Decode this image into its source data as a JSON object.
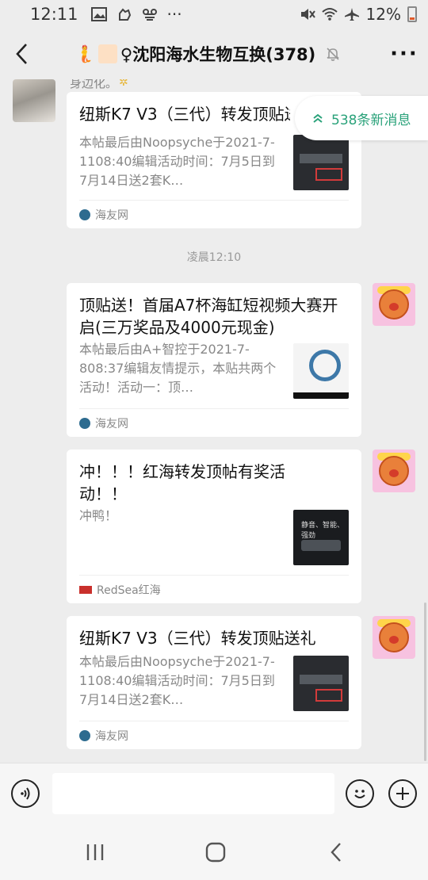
{
  "status_bar": {
    "time": "12:11",
    "left_icons": [
      "image-icon",
      "hand-icon",
      "voicemail-icon",
      "more-dots-icon"
    ],
    "more": "···",
    "battery": "12%"
  },
  "header": {
    "title_prefix": "🧜",
    "title": "♀沈阳海水生物互换(378)",
    "more": "···"
  },
  "new_messages_badge": {
    "icon": "double-chevron-up-icon",
    "label": "538条新消息"
  },
  "messages": [
    {
      "partial_text": "身边化。",
      "title": "纽斯K7 V3（三代）转发顶贴送礼",
      "desc": "本帖最后由Noopsyche于2021-7-1108:40编辑活动时间：7月5日到7月14日送2套K…",
      "source": "海友网"
    },
    {
      "timestamp": "凌晨12:10"
    },
    {
      "title": "顶贴送！首届A7杯海缸短视频大赛开启(三万奖品及4000元现金)",
      "desc": "本帖最后由A+智控于2021-7-808:37编辑友情提示，本贴共两个活动！活动一：顶…",
      "source": "海友网"
    },
    {
      "title": "冲！！！红海转发顶帖有奖活动！！",
      "desc": "冲鸭！",
      "thumb_text": "静音、智能、强劲",
      "source": "RedSea红海"
    },
    {
      "title": "纽斯K7 V3（三代）转发顶贴送礼",
      "desc": "本帖最后由Noopsyche于2021-7-1108:40编辑活动时间：7月5日到7月14日送2套K…",
      "source": "海友网"
    }
  ],
  "input_bar": {
    "value": ""
  },
  "colors": {
    "background": "#ededed",
    "card": "#ffffff",
    "new_msg_green": "#2aa27a"
  }
}
